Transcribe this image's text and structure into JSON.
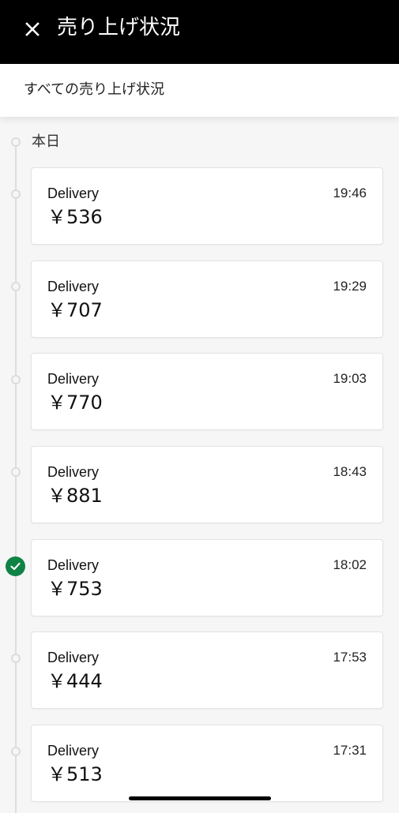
{
  "header": {
    "title": "売り上げ状況",
    "close_icon": "close-icon"
  },
  "subheader": {
    "link": "すべての売り上げ状況"
  },
  "timeline": {
    "day_label": "本日",
    "accent_color": "#0e8345"
  },
  "earnings": [
    {
      "type": "Delivery",
      "time": "19:46",
      "amount": "￥536"
    },
    {
      "type": "Delivery",
      "time": "19:29",
      "amount": "￥707"
    },
    {
      "type": "Delivery",
      "time": "19:03",
      "amount": "￥770"
    },
    {
      "type": "Delivery",
      "time": "18:43",
      "amount": "￥881"
    },
    {
      "type": "Delivery",
      "time": "18:02",
      "amount": "￥753",
      "checked": true
    },
    {
      "type": "Delivery",
      "time": "17:53",
      "amount": "￥444"
    },
    {
      "type": "Delivery",
      "time": "17:31",
      "amount": "￥513"
    }
  ]
}
